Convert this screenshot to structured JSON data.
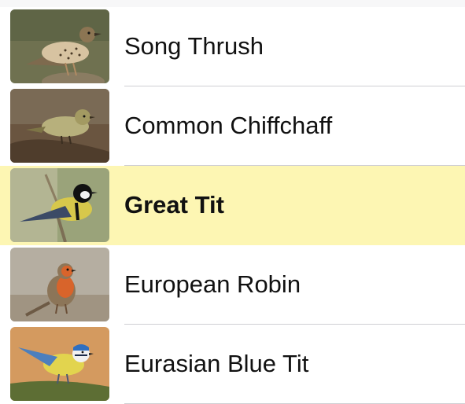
{
  "birds": [
    {
      "name": "Song Thrush",
      "selected": false,
      "thumbnail_icon": "song-thrush-photo"
    },
    {
      "name": "Common Chiffchaff",
      "selected": false,
      "thumbnail_icon": "common-chiffchaff-photo"
    },
    {
      "name": "Great Tit",
      "selected": true,
      "thumbnail_icon": "great-tit-photo"
    },
    {
      "name": "European Robin",
      "selected": false,
      "thumbnail_icon": "european-robin-photo"
    },
    {
      "name": "Eurasian Blue Tit",
      "selected": false,
      "thumbnail_icon": "eurasian-blue-tit-photo"
    }
  ],
  "colors": {
    "selected_row_background": "#fdf6b3",
    "separator": "#cfcfd3",
    "text": "#111111"
  }
}
